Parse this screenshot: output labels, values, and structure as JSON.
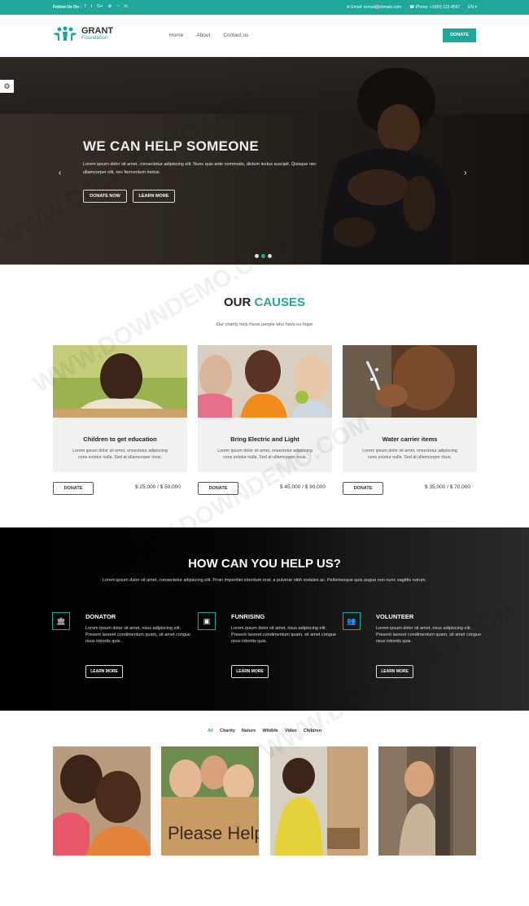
{
  "topbar": {
    "follow": "Follow Us On :",
    "social_icons": [
      "facebook-icon",
      "twitter-icon",
      "google-plus-icon",
      "pinterest-icon",
      "rss-icon",
      "linkedin-icon"
    ],
    "email": "Email: xxmail@domain.com",
    "phone": "Phone: +1(00) 123-4567",
    "lang": "EN ▾"
  },
  "header": {
    "logo_line1": "GRANT",
    "logo_line2": "Foundation",
    "nav": [
      "Home",
      "About",
      "Contact us"
    ],
    "donate": "DONATE"
  },
  "hero": {
    "title": "WE CAN HELP SOMEONE",
    "text": "Lorem ipsum dolor sit amet, consectetur adipiscing elit. Nunc quis ante commodo, dictum lectus suscipit. Quisque nec ullamcorper elit, nec fermentum metus.",
    "btn_donate": "DONATE NOW",
    "btn_learn": "LEARN MORE",
    "prev": "‹",
    "next": "›",
    "gear": "⚙"
  },
  "causes": {
    "title_a": "OUR ",
    "title_b": "CAUSES",
    "subtitle": "Our charity help those people who have no hope",
    "btn": "DONATE",
    "items": [
      {
        "title": "Children to get education",
        "text": "Lorem ipsum dolor sit amet, onsectetur adipiscing cons ectetur nulla. Sed at ullamcorper risus.",
        "amount": "$ 25,000 / $ 50,000"
      },
      {
        "title": "Bring Electric and Light",
        "text": "Lorem ipsum dolor sit amet, onsectetur adipiscing cons ectetur nulla. Sed at ullamcorper risus.",
        "amount": "$ 45,000 / $ 90,000"
      },
      {
        "title": "Water carrier items",
        "text": "Lorem ipsum dolor sit amet, onsectetur adipiscing cons ectetur nulla. Sed at ullamcorper risus.",
        "amount": "$ 35,000 / $ 70,000"
      }
    ]
  },
  "help": {
    "title": "HOW CAN YOU HELP US?",
    "lead": "Lorem ipsum dolor sit amet, consectetur adipiscing elit. Proin imperdiet interdum erat, a pulvinar nibh sodales ac. Pellentesque quis augue non nunc sagittis rutrum.",
    "btn": "LEARN MORE",
    "items": [
      {
        "title": "DONATOR",
        "icon": "bank-icon",
        "text": "Lorem ipsum dolor sit amet, risus adipiscing elit. Present laoreet condimentum quam, sit amet congue risus lobortis quis."
      },
      {
        "title": "FUNRISING",
        "icon": "money-icon",
        "text": "Lorem ipsum dolor sit amet, risus adipiscing elit. Present laoreet condimentum quam, sit amet congue risus lobortis quis."
      },
      {
        "title": "VOLUNTEER",
        "icon": "users-icon",
        "text": "Lorem ipsum dolor sit amet, risus adipiscing elit. Present laoreet condimentum quam, sit amet congue risus lobortis quis."
      }
    ]
  },
  "gallery": {
    "filters": [
      "All",
      "Charity",
      "Nature",
      "Wildlife",
      "Video",
      "Children"
    ],
    "active": "All",
    "sign_text": "Please Help"
  },
  "watermark": "WWW.DOWNDEMO.COM",
  "colors": {
    "accent": "#1fa79a",
    "dark": "#000000"
  }
}
